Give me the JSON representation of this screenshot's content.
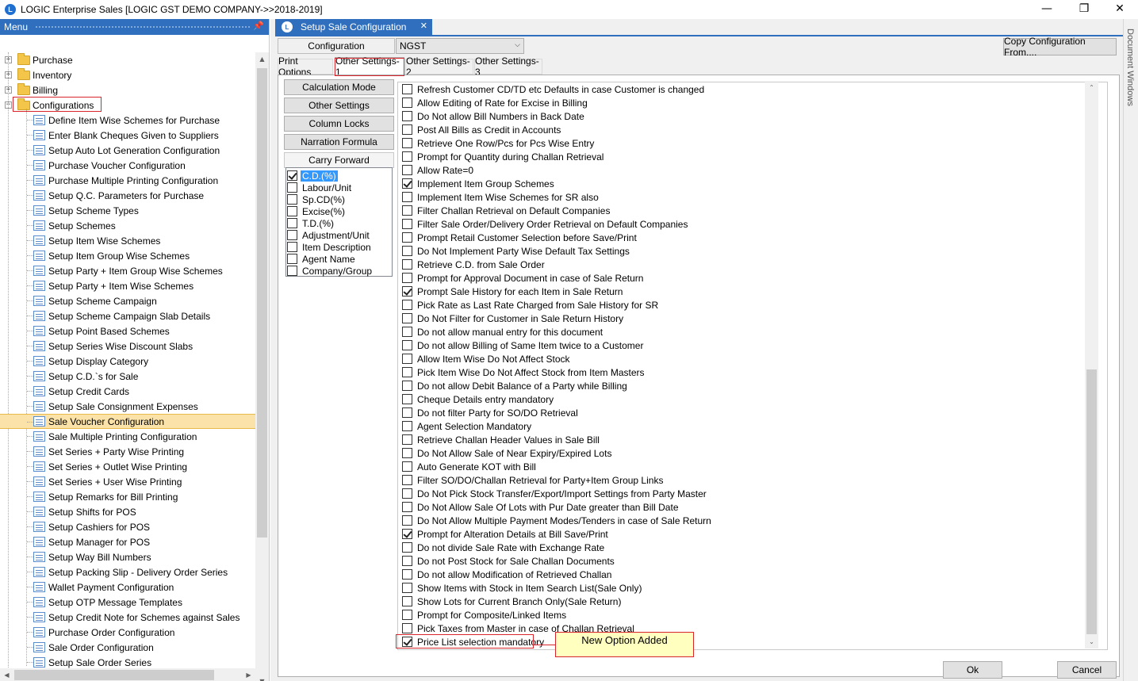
{
  "window": {
    "title": "LOGIC Enterprise Sales  [LOGIC GST DEMO COMPANY->>2018-2019]",
    "minimize": "—",
    "restore": "❐",
    "close": "✕"
  },
  "menu": {
    "header": "Menu",
    "pin_icon": "pin-icon",
    "top_items": [
      {
        "label": "Purchase",
        "expander": "+"
      },
      {
        "label": "Inventory",
        "expander": "+"
      },
      {
        "label": "Billing",
        "expander": "+"
      },
      {
        "label": "Configurations",
        "expander": "−"
      }
    ],
    "children": [
      "Define Item Wise Schemes for Purchase",
      "Enter Blank Cheques Given to Suppliers",
      "Setup Auto Lot Generation Configuration",
      "Purchase Voucher Configuration",
      "Purchase Multiple Printing Configuration",
      "Setup Q.C. Parameters for Purchase",
      "Setup Scheme Types",
      "Setup Schemes",
      "Setup Item Wise Schemes",
      "Setup Item Group Wise Schemes",
      "Setup Party + Item Group Wise Schemes",
      "Setup Party + Item Wise Schemes",
      "Setup Scheme Campaign",
      "Setup Scheme Campaign Slab Details",
      "Setup Point Based Schemes",
      "Setup Series Wise Discount Slabs",
      "Setup Display Category",
      "Setup C.D.`s for Sale",
      "Setup Credit Cards",
      "Setup Sale Consignment Expenses",
      "Sale Voucher Configuration",
      "Sale Multiple Printing Configuration",
      "Set Series + Party Wise Printing",
      "Set Series + Outlet Wise Printing",
      "Set Series + User Wise Printing",
      "Setup Remarks for Bill Printing",
      "Setup Shifts for POS",
      "Setup Cashiers for POS",
      "Setup Manager for POS",
      "Setup Way Bill Numbers",
      "Setup Packing Slip - Delivery Order Series",
      "Wallet Payment Configuration",
      "Setup OTP Message Templates",
      "Setup Credit Note for Schemes against Sales",
      "Purchase Order Configuration",
      "Sale Order Configuration",
      "Setup Sale Order Series"
    ],
    "selected_index": 20
  },
  "document": {
    "tab_title": "Setup Sale Configuration",
    "configuration_label": "Configuration",
    "configuration_value": "NGST",
    "copy_button": "Copy Configuration From....",
    "tabs": [
      "Print Options",
      "Other Settings-1",
      "Other Settings-2",
      "Other Settings-3"
    ],
    "active_tab": 1,
    "side_buttons": [
      "Calculation Mode",
      "Other Settings",
      "Column Locks",
      "Narration Formula",
      "Carry Forward"
    ],
    "active_side_button": 4,
    "carry_forward_fields": [
      {
        "label": "C.D.(%)",
        "checked": true,
        "selected": true
      },
      {
        "label": "Labour/Unit",
        "checked": false
      },
      {
        "label": "Sp.CD(%)",
        "checked": false
      },
      {
        "label": "Excise(%)",
        "checked": false
      },
      {
        "label": "T.D.(%)",
        "checked": false
      },
      {
        "label": "Adjustment/Unit",
        "checked": false
      },
      {
        "label": "Item Description",
        "checked": false
      },
      {
        "label": "Agent Name",
        "checked": false
      },
      {
        "label": "Company/Group",
        "checked": false
      }
    ],
    "options": [
      {
        "label": "Refresh Customer CD/TD etc Defaults in case Customer is changed",
        "checked": false
      },
      {
        "label": "Allow Editing of Rate for Excise in Billing",
        "checked": false
      },
      {
        "label": "Do Not allow Bill Numbers in Back Date",
        "checked": false
      },
      {
        "label": "Post All Bills as Credit in Accounts",
        "checked": false
      },
      {
        "label": "Retrieve One Row/Pcs for Pcs Wise Entry",
        "checked": false
      },
      {
        "label": "Prompt for Quantity during Challan Retrieval",
        "checked": false
      },
      {
        "label": "Allow Rate=0",
        "checked": false
      },
      {
        "label": "Implement Item Group Schemes",
        "checked": true
      },
      {
        "label": "Implement Item Wise Schemes for SR also",
        "checked": false
      },
      {
        "label": "Filter Challan Retrieval on Default Companies",
        "checked": false
      },
      {
        "label": "Filter Sale Order/Delivery Order Retrieval on Default Companies",
        "checked": false
      },
      {
        "label": "Prompt Retail Customer Selection before Save/Print",
        "checked": false
      },
      {
        "label": "Do Not Implement Party Wise Default Tax Settings",
        "checked": false
      },
      {
        "label": "Retrieve C.D. from Sale Order",
        "checked": false
      },
      {
        "label": "Prompt for Approval Document in case of Sale Return",
        "checked": false
      },
      {
        "label": "Prompt Sale History for each Item in Sale Return",
        "checked": true
      },
      {
        "label": "Pick Rate as Last Rate Charged from Sale History for SR",
        "checked": false
      },
      {
        "label": "Do Not Filter for Customer in Sale Return History",
        "checked": false
      },
      {
        "label": "Do not allow manual entry for this document",
        "checked": false
      },
      {
        "label": "Do not allow Billing of Same Item twice to a Customer",
        "checked": false
      },
      {
        "label": "Allow Item Wise Do Not Affect Stock",
        "checked": false
      },
      {
        "label": "Pick Item Wise Do Not Affect Stock from Item Masters",
        "checked": false
      },
      {
        "label": "Do not allow Debit Balance of a Party while Billing",
        "checked": false
      },
      {
        "label": "Cheque Details entry mandatory",
        "checked": false
      },
      {
        "label": "Do not filter Party for SO/DO Retrieval",
        "checked": false
      },
      {
        "label": "Agent Selection Mandatory",
        "checked": false
      },
      {
        "label": "Retrieve Challan Header Values in Sale Bill",
        "checked": false
      },
      {
        "label": "Do Not Allow Sale of Near Expiry/Expired Lots",
        "checked": false
      },
      {
        "label": "Auto Generate KOT with Bill",
        "checked": false
      },
      {
        "label": "Filter SO/DO/Challan Retrieval for Party+Item Group Links",
        "checked": false
      },
      {
        "label": "Do Not Pick Stock Transfer/Export/Import Settings from Party Master",
        "checked": false
      },
      {
        "label": "Do Not Allow Sale Of Lots with Pur Date greater than Bill Date",
        "checked": false
      },
      {
        "label": "Do Not Allow Multiple Payment Modes/Tenders in case of Sale Return",
        "checked": false
      },
      {
        "label": "Prompt for Alteration Details at Bill Save/Print",
        "checked": true
      },
      {
        "label": "Do not divide Sale Rate with Exchange Rate",
        "checked": false
      },
      {
        "label": "Do not Post Stock for Sale Challan Documents",
        "checked": false
      },
      {
        "label": "Do not allow Modification of Retrieved Challan",
        "checked": false
      },
      {
        "label": "Show Items with Stock in Item Search List(Sale Only)",
        "checked": false
      },
      {
        "label": "Show Lots for Current Branch Only(Sale Return)",
        "checked": false
      },
      {
        "label": "Prompt for Composite/Linked Items",
        "checked": false
      },
      {
        "label": "Pick Taxes from Master in case of Challan Retrieval",
        "checked": false
      },
      {
        "label": "Price List selection mandatory",
        "checked": true
      }
    ],
    "callout": "New Option Added",
    "ok_button": "Ok",
    "cancel_button": "Cancel",
    "doc_windows_label": "Document Windows"
  }
}
